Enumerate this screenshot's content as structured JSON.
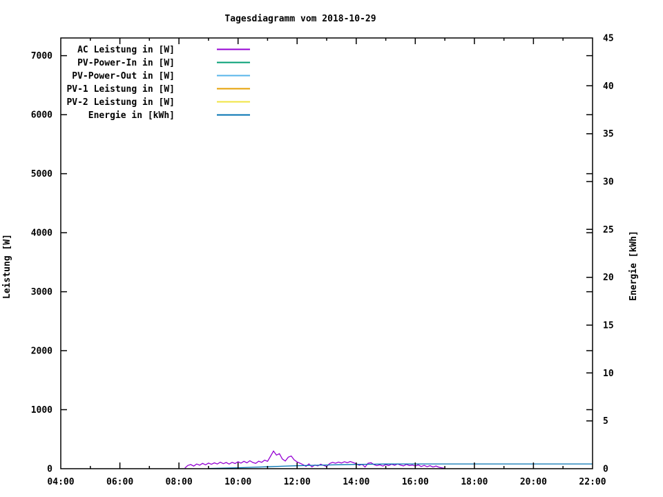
{
  "title": "Tagesdiagramm vom 2018-10-29",
  "chart_data": {
    "type": "line",
    "title": "Tagesdiagramm vom 2018-10-29",
    "grid": false,
    "legend_position": "top-left",
    "x_axis": {
      "label": "",
      "unit": "time",
      "range_hours": [
        4,
        22
      ],
      "ticks_hours": [
        4,
        6,
        8,
        10,
        12,
        14,
        16,
        18,
        20,
        22
      ],
      "tick_labels": [
        "04:00",
        "06:00",
        "08:00",
        "10:00",
        "12:00",
        "14:00",
        "16:00",
        "18:00",
        "20:00",
        "22:00"
      ],
      "minor_ticks_hours": [
        5,
        7,
        9,
        11,
        13,
        15,
        17,
        19,
        21
      ]
    },
    "y_axis_left": {
      "label": "Leistung [W]",
      "range": [
        0,
        7300
      ],
      "ticks": [
        0,
        1000,
        2000,
        3000,
        4000,
        5000,
        6000,
        7000
      ]
    },
    "y_axis_right": {
      "label": "Energie [kWh]",
      "range": [
        0,
        45
      ],
      "ticks": [
        0,
        5,
        10,
        15,
        20,
        25,
        30,
        35,
        40,
        45
      ]
    },
    "series": [
      {
        "label": "AC Leistung in [W]",
        "color": "#9400d3",
        "axis": "left",
        "points": [
          [
            8.2,
            10
          ],
          [
            8.3,
            55
          ],
          [
            8.4,
            70
          ],
          [
            8.5,
            45
          ],
          [
            8.6,
            80
          ],
          [
            8.7,
            60
          ],
          [
            8.8,
            90
          ],
          [
            8.9,
            65
          ],
          [
            9.0,
            95
          ],
          [
            9.1,
            75
          ],
          [
            9.2,
            100
          ],
          [
            9.3,
            80
          ],
          [
            9.4,
            110
          ],
          [
            9.5,
            85
          ],
          [
            9.6,
            105
          ],
          [
            9.7,
            78
          ],
          [
            9.8,
            108
          ],
          [
            9.9,
            88
          ],
          [
            10.0,
            118
          ],
          [
            10.1,
            95
          ],
          [
            10.2,
            125
          ],
          [
            10.3,
            100
          ],
          [
            10.4,
            135
          ],
          [
            10.5,
            105
          ],
          [
            10.6,
            90
          ],
          [
            10.7,
            128
          ],
          [
            10.8,
            108
          ],
          [
            10.9,
            145
          ],
          [
            11.0,
            125
          ],
          [
            11.1,
            210
          ],
          [
            11.2,
            300
          ],
          [
            11.3,
            230
          ],
          [
            11.4,
            255
          ],
          [
            11.5,
            165
          ],
          [
            11.6,
            130
          ],
          [
            11.7,
            195
          ],
          [
            11.8,
            215
          ],
          [
            11.9,
            150
          ],
          [
            12.0,
            115
          ],
          [
            12.1,
            92
          ],
          [
            12.2,
            68
          ],
          [
            12.3,
            40
          ],
          [
            12.4,
            82
          ],
          [
            12.5,
            30
          ],
          [
            12.6,
            62
          ],
          [
            12.7,
            48
          ],
          [
            12.8,
            76
          ],
          [
            12.9,
            55
          ],
          [
            13.0,
            38
          ],
          [
            13.1,
            88
          ],
          [
            13.2,
            108
          ],
          [
            13.3,
            92
          ],
          [
            13.4,
            112
          ],
          [
            13.5,
            96
          ],
          [
            13.6,
            118
          ],
          [
            13.7,
            102
          ],
          [
            13.8,
            122
          ],
          [
            13.9,
            104
          ],
          [
            14.0,
            84
          ],
          [
            14.1,
            58
          ],
          [
            14.2,
            74
          ],
          [
            14.3,
            28
          ],
          [
            14.4,
            92
          ],
          [
            14.5,
            102
          ],
          [
            14.6,
            70
          ],
          [
            14.7,
            52
          ],
          [
            14.8,
            66
          ],
          [
            14.9,
            44
          ],
          [
            15.0,
            70
          ],
          [
            15.1,
            54
          ],
          [
            15.2,
            76
          ],
          [
            15.3,
            58
          ],
          [
            15.4,
            80
          ],
          [
            15.5,
            62
          ],
          [
            15.6,
            48
          ],
          [
            15.7,
            72
          ],
          [
            15.8,
            54
          ],
          [
            15.9,
            62
          ],
          [
            16.0,
            44
          ],
          [
            16.1,
            66
          ],
          [
            16.2,
            38
          ],
          [
            16.3,
            56
          ],
          [
            16.4,
            34
          ],
          [
            16.5,
            52
          ],
          [
            16.6,
            28
          ],
          [
            16.7,
            46
          ],
          [
            16.8,
            24
          ],
          [
            16.9,
            14
          ],
          [
            17.0,
            6
          ]
        ]
      },
      {
        "label": "PV-Power-In in [W]",
        "color": "#009e73",
        "axis": "left",
        "points": []
      },
      {
        "label": "PV-Power-Out in [W]",
        "color": "#56b4e9",
        "axis": "left",
        "points": []
      },
      {
        "label": "PV-1 Leistung in [W]",
        "color": "#e69f00",
        "axis": "left",
        "points": []
      },
      {
        "label": "PV-2 Leistung in [W]",
        "color": "#f0e442",
        "axis": "left",
        "points": []
      },
      {
        "label": "Energie in [kWh]",
        "color": "#0072b2",
        "axis": "right",
        "points": [
          [
            9.0,
            0.02
          ],
          [
            9.5,
            0.06
          ],
          [
            10.0,
            0.1
          ],
          [
            10.5,
            0.15
          ],
          [
            11.0,
            0.2
          ],
          [
            11.5,
            0.26
          ],
          [
            12.0,
            0.31
          ],
          [
            12.5,
            0.35
          ],
          [
            13.0,
            0.39
          ],
          [
            13.5,
            0.42
          ],
          [
            14.0,
            0.45
          ],
          [
            14.5,
            0.47
          ],
          [
            15.0,
            0.49
          ],
          [
            15.5,
            0.5
          ],
          [
            16.0,
            0.5
          ],
          [
            17.0,
            0.5
          ],
          [
            18.0,
            0.5
          ],
          [
            19.0,
            0.5
          ],
          [
            20.0,
            0.5
          ],
          [
            21.0,
            0.5
          ],
          [
            22.0,
            0.5
          ]
        ]
      }
    ]
  }
}
